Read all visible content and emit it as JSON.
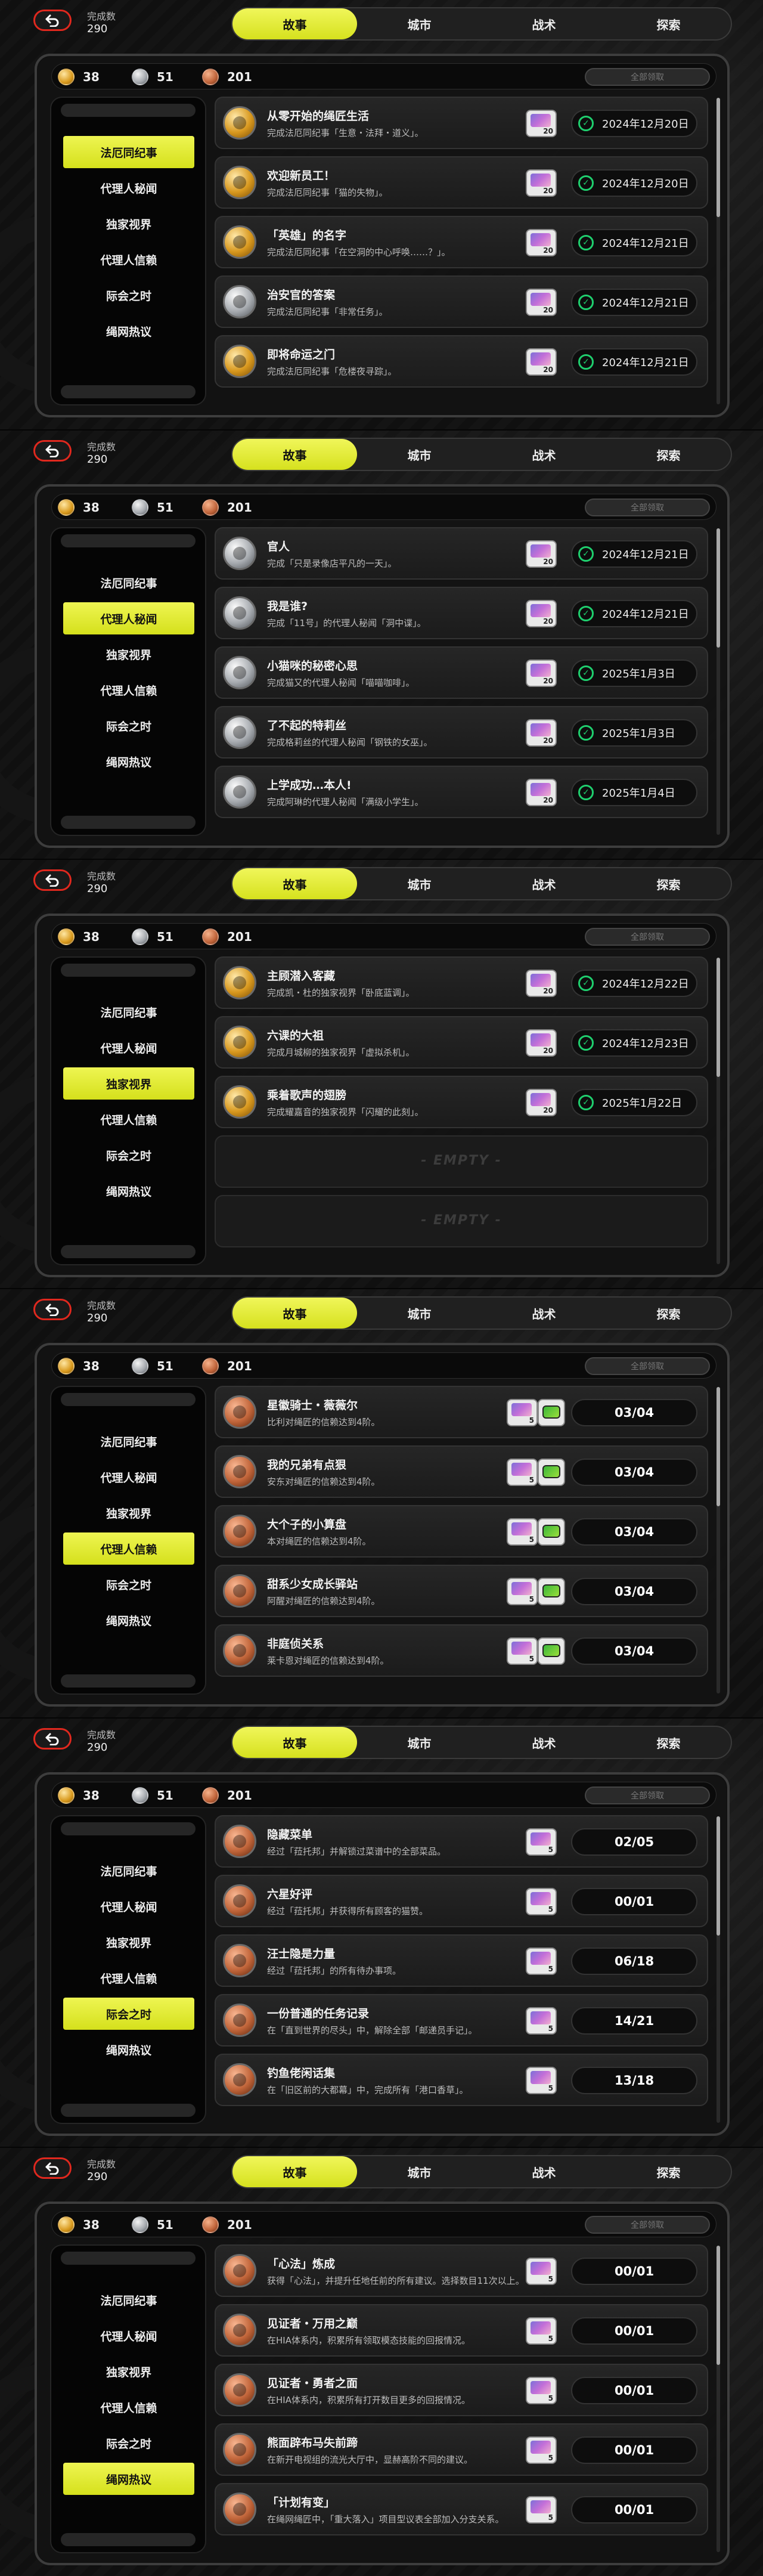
{
  "common": {
    "count_label": "完成数",
    "count_value": "290",
    "tabs": [
      "故事",
      "城市",
      "战术",
      "探索"
    ],
    "currencies": [
      {
        "value": "38",
        "kind": "gold"
      },
      {
        "value": "51",
        "kind": "silver"
      },
      {
        "value": "201",
        "kind": "bronze"
      }
    ],
    "claim_all": "全部领取",
    "sidebar": [
      "法厄同纪事",
      "代理人秘闻",
      "独家视界",
      "代理人信赖",
      "际会之时",
      "绳网热议"
    ],
    "empty_text": "- EMPTY -"
  },
  "screens": [
    {
      "active_tab": 0,
      "active_side": 0,
      "cards": [
        {
          "medal": "gold",
          "title": "从零开始的绳匠生活",
          "desc": "完成法厄同纪事「生意・法拜・道义」。",
          "reward_qty": "20",
          "kind": "date",
          "value": "2024年12月20日"
        },
        {
          "medal": "gold",
          "title": "欢迎新员工！",
          "desc": "完成法厄同纪事「猫的失物」。",
          "reward_qty": "20",
          "kind": "date",
          "value": "2024年12月20日"
        },
        {
          "medal": "gold",
          "title": "「英雄」的名字",
          "desc": "完成法厄同纪事「在空洞的中心呼唤……？」。",
          "reward_qty": "20",
          "kind": "date",
          "value": "2024年12月21日"
        },
        {
          "medal": "silver",
          "title": "治安官的答案",
          "desc": "完成法厄同纪事「非常任务」。",
          "reward_qty": "20",
          "kind": "date",
          "value": "2024年12月21日"
        },
        {
          "medal": "gold",
          "title": "即将命运之门",
          "desc": "完成法厄同纪事「危楼夜寻踪」。",
          "reward_qty": "20",
          "kind": "date",
          "value": "2024年12月21日"
        }
      ]
    },
    {
      "active_tab": 0,
      "active_side": 1,
      "cards": [
        {
          "medal": "silver",
          "title": "官人",
          "desc": "完成「只是录像店平凡的一天」。",
          "reward_qty": "20",
          "kind": "date",
          "value": "2024年12月21日"
        },
        {
          "medal": "silver",
          "title": "我是谁?",
          "desc": "完成「11号」的代理人秘闻「洞中谍」。",
          "reward_qty": "20",
          "kind": "date",
          "value": "2024年12月21日"
        },
        {
          "medal": "silver",
          "title": "小猫咪的秘密心思",
          "desc": "完成猫又的代理人秘闻「喵喵咖啡」。",
          "reward_qty": "20",
          "kind": "date",
          "value": "2025年1月3日"
        },
        {
          "medal": "silver",
          "title": "了不起的特莉丝",
          "desc": "完成格莉丝的代理人秘闻「钢铁的女巫」。",
          "reward_qty": "20",
          "kind": "date",
          "value": "2025年1月3日"
        },
        {
          "medal": "silver",
          "title": "上学成功…本人!",
          "desc": "完成阿琳的代理人秘闻「满级小学生」。",
          "reward_qty": "20",
          "kind": "date",
          "value": "2025年1月4日"
        }
      ]
    },
    {
      "active_tab": 0,
      "active_side": 2,
      "cards": [
        {
          "medal": "gold",
          "title": "主顾潜入客藏",
          "desc": "完成凯・杜的独家视界「卧底蓝调」。",
          "reward_qty": "20",
          "kind": "date",
          "value": "2024年12月22日"
        },
        {
          "medal": "gold",
          "title": "六课的大祖",
          "desc": "完成月城柳的独家视界「虚拟杀机」。",
          "reward_qty": "20",
          "kind": "date",
          "value": "2024年12月23日"
        },
        {
          "medal": "gold",
          "title": "乘着歌声的翅膀",
          "desc": "完成耀嘉音的独家视界「闪耀的此刻」。",
          "reward_qty": "20",
          "kind": "date",
          "value": "2025年1月22日"
        },
        {
          "empty": true
        },
        {
          "empty": true
        }
      ]
    },
    {
      "active_tab": 0,
      "active_side": 3,
      "cards": [
        {
          "medal": "bronze",
          "title": "星徽骑士・薇薇尔",
          "desc": "比利对绳匠的信赖达到4阶。",
          "reward_qty": "5",
          "kind": "progress",
          "value": "03/04",
          "double": true
        },
        {
          "medal": "bronze",
          "title": "我的兄弟有点狠",
          "desc": "安东对绳匠的信赖达到4阶。",
          "reward_qty": "5",
          "kind": "progress",
          "value": "03/04",
          "double": true
        },
        {
          "medal": "bronze",
          "title": "大个子的小算盘",
          "desc": "本对绳匠的信赖达到4阶。",
          "reward_qty": "5",
          "kind": "progress",
          "value": "03/04",
          "double": true
        },
        {
          "medal": "bronze",
          "title": "甜系少女成长驿站",
          "desc": "阿醒对绳匠的信赖达到4阶。",
          "reward_qty": "5",
          "kind": "progress",
          "value": "03/04",
          "double": true
        },
        {
          "medal": "bronze",
          "title": "非庭侦关系",
          "desc": "莱卡恩对绳匠的信赖达到4阶。",
          "reward_qty": "5",
          "kind": "progress",
          "value": "03/04",
          "double": true
        }
      ]
    },
    {
      "active_tab": 0,
      "active_side": 4,
      "cards": [
        {
          "medal": "bronze",
          "title": "隐藏菜单",
          "desc": "经过「菈托邦」并解锁过菜谱中的全部菜品。",
          "reward_qty": "5",
          "kind": "progress",
          "value": "02/05"
        },
        {
          "medal": "bronze",
          "title": "六星好评",
          "desc": "经过「菈托邦」并获得所有顾客的猫赞。",
          "reward_qty": "5",
          "kind": "progress",
          "value": "00/01"
        },
        {
          "medal": "bronze",
          "title": "汪士隐是力量",
          "desc": "经过「菈托邦」的所有待办事项。",
          "reward_qty": "5",
          "kind": "progress",
          "value": "06/18"
        },
        {
          "medal": "bronze",
          "title": "一份普通的任务记录",
          "desc": "在「直到世界的尽头」中，解除全部「邮递员手记」。",
          "reward_qty": "5",
          "kind": "progress",
          "value": "14/21"
        },
        {
          "medal": "bronze",
          "title": "钓鱼佬闲话集",
          "desc": "在「旧区前的大都幕」中，完成所有「港口香草」。",
          "reward_qty": "5",
          "kind": "progress",
          "value": "13/18"
        }
      ]
    },
    {
      "active_tab": 0,
      "active_side": 5,
      "cards": [
        {
          "medal": "bronze",
          "title": "「心法」炼成",
          "desc": "获得「心法」，并提升任地任前的所有建议。选择数目11次以上。",
          "reward_qty": "5",
          "kind": "progress",
          "value": "00/01"
        },
        {
          "medal": "bronze",
          "title": "见证者・万用之巅",
          "desc": "在HIA体系内，积累所有领取模态技能的回报情况。",
          "reward_qty": "5",
          "kind": "progress",
          "value": "00/01"
        },
        {
          "medal": "bronze",
          "title": "见证者・勇者之面",
          "desc": "在HIA体系内，积累所有打开数目更多的回报情况。",
          "reward_qty": "5",
          "kind": "progress",
          "value": "00/01"
        },
        {
          "medal": "bronze",
          "title": "熊面辟布马失前蹄",
          "desc": "在新开电视组的流光大厅中，显赫高阶不同的建议。",
          "reward_qty": "5",
          "kind": "progress",
          "value": "00/01"
        },
        {
          "medal": "bronze",
          "title": "「计划有变」",
          "desc": "在绳网绳匠中，「重大落入」项目型议表全部加入分支关系。",
          "reward_qty": "5",
          "kind": "progress",
          "value": "00/01"
        }
      ]
    }
  ]
}
